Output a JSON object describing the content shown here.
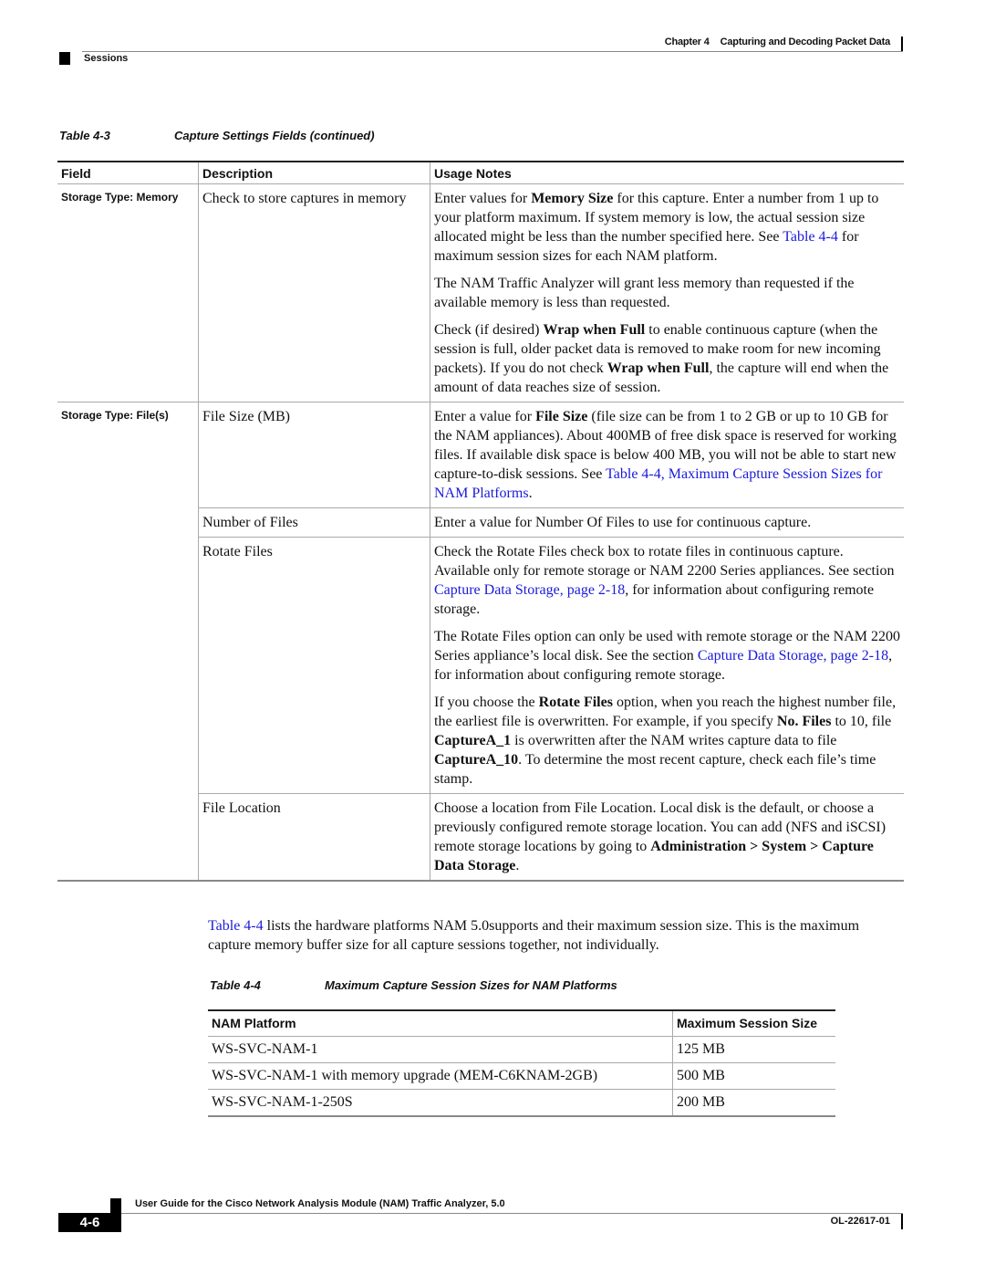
{
  "header": {
    "chapter_label": "Chapter 4",
    "chapter_title": "Capturing and Decoding Packet Data",
    "section": "Sessions"
  },
  "table3": {
    "caption_number": "Table 4-3",
    "caption_title": "Capture Settings Fields (continued)",
    "columns": [
      "Field",
      "Description",
      "Usage Notes"
    ],
    "rows": [
      {
        "field": "Storage Type: Memory",
        "description": "Check to store captures in memory",
        "notes": [
          {
            "segments": [
              {
                "t": "Enter values for "
              },
              {
                "t": "Memory Size",
                "b": true
              },
              {
                "t": " for this capture. Enter a number from 1 up to your platform maximum. If system memory is low, the actual session size allocated might be less than the number specified here. See "
              },
              {
                "t": "Table 4-4",
                "link": true
              },
              {
                "t": " for maximum session sizes for each NAM platform."
              }
            ]
          },
          {
            "segments": [
              {
                "t": "The NAM Traffic Analyzer will grant less memory than requested if the available memory is less than requested."
              }
            ]
          },
          {
            "segments": [
              {
                "t": "Check (if desired) "
              },
              {
                "t": "Wrap when Full",
                "b": true
              },
              {
                "t": " to enable continuous capture (when the session is full, older packet data is removed to make room for new incoming packets). If you do not check "
              },
              {
                "t": "Wrap when Full",
                "b": true
              },
              {
                "t": ", the capture will end when the amount of data reaches size of session."
              }
            ]
          }
        ]
      },
      {
        "field": "Storage Type: File(s)",
        "description": "File Size (MB)",
        "notes": [
          {
            "segments": [
              {
                "t": "Enter a value for "
              },
              {
                "t": "File Size",
                "b": true
              },
              {
                "t": " (file size can be from 1 to 2 GB or up to 10 GB for the NAM appliances). About 400MB of free disk space is reserved for working files. If available disk space is below 400 MB, you will not be able to start new capture-to-disk sessions. See "
              },
              {
                "t": "Table 4-4, Maximum Capture Session Sizes for NAM Platforms",
                "link": true
              },
              {
                "t": "."
              }
            ]
          }
        ]
      },
      {
        "field": "",
        "description": "Number of Files",
        "notes": [
          {
            "segments": [
              {
                "t": "Enter a value for Number Of Files to use for continuous capture."
              }
            ]
          }
        ]
      },
      {
        "field": "",
        "description": "Rotate Files",
        "notes": [
          {
            "segments": [
              {
                "t": "Check the Rotate Files check box to rotate files in continuous capture. Available only for remote storage or NAM 2200 Series appliances. See section "
              },
              {
                "t": "Capture Data Storage, page 2-18",
                "link": true
              },
              {
                "t": ", for information about configuring remote storage."
              }
            ]
          },
          {
            "segments": [
              {
                "t": "The Rotate Files option can only be used with remote storage or the NAM 2200 Series appliance’s local disk. See the section "
              },
              {
                "t": "Capture Data Storage, page 2-18",
                "link": true
              },
              {
                "t": ", for information about configuring remote storage."
              }
            ]
          },
          {
            "segments": [
              {
                "t": "If you choose the "
              },
              {
                "t": "Rotate Files",
                "b": true
              },
              {
                "t": " option, when you reach the highest number file, the earliest file is overwritten. For example, if you specify "
              },
              {
                "t": "No. Files",
                "b": true
              },
              {
                "t": " to 10, file "
              },
              {
                "t": "CaptureA_1",
                "b": true
              },
              {
                "t": " is overwritten after the NAM writes capture data to file "
              },
              {
                "t": "CaptureA_10",
                "b": true
              },
              {
                "t": ". To determine the most recent capture, check each file’s time stamp."
              }
            ]
          }
        ]
      },
      {
        "field": "",
        "description": "File Location",
        "notes": [
          {
            "segments": [
              {
                "t": "Choose a location from File Location. Local disk is the default, or choose a previously configured remote storage location. You can add (NFS and iSCSI) remote storage locations by going to "
              },
              {
                "t": "Administration > System > Capture Data Storage",
                "b": true
              },
              {
                "t": "."
              }
            ]
          }
        ]
      }
    ]
  },
  "intro": {
    "link": "Table 4-4",
    "text": " lists the hardware platforms NAM 5.0supports and their maximum session size. This is the maximum capture memory buffer size for all capture sessions together, not individually."
  },
  "table4": {
    "caption_number": "Table 4-4",
    "caption_title": "Maximum Capture Session Sizes for NAM Platforms",
    "columns": [
      "NAM Platform",
      "Maximum Session Size"
    ],
    "rows": [
      {
        "platform": "WS-SVC-NAM-1",
        "size": "125 MB"
      },
      {
        "platform": "WS-SVC-NAM-1 with memory upgrade (MEM-C6KNAM-2GB)",
        "size": "500 MB"
      },
      {
        "platform": "WS-SVC-NAM-1-250S",
        "size": "200 MB"
      }
    ]
  },
  "footer": {
    "title": "User Guide for the Cisco Network Analysis Module (NAM) Traffic Analyzer, 5.0",
    "page": "4-6",
    "doc_number": "OL-22617-01"
  }
}
